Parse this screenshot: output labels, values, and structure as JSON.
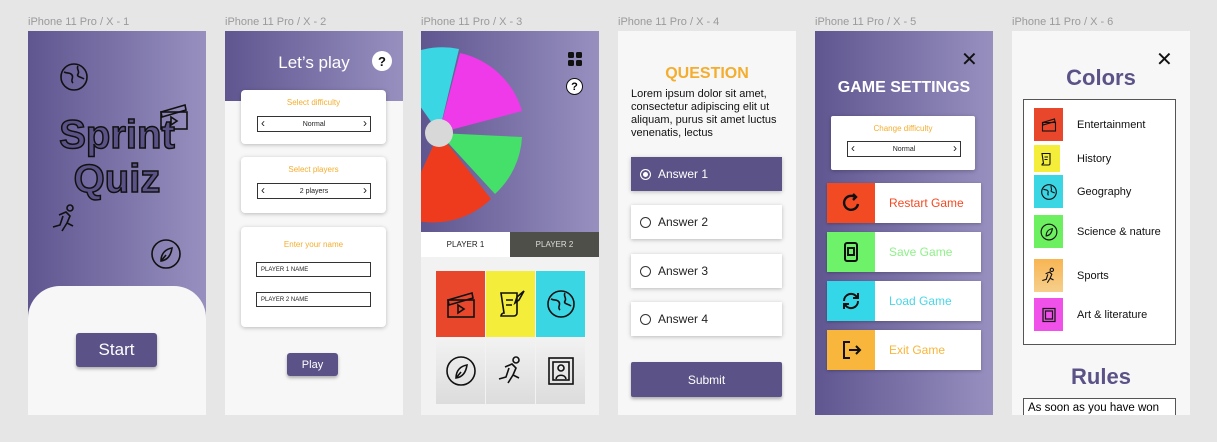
{
  "frames": {
    "f1": {
      "label": "iPhone 11 Pro / X - 1",
      "title_line1": "Sprint",
      "title_line2": "Quiz",
      "start": "Start"
    },
    "f2": {
      "label": "iPhone 11 Pro / X - 2",
      "title": "Let’s play",
      "help": "?",
      "difficulty_heading": "Select difficulty",
      "difficulty_value": "Normal",
      "players_heading": "Select players",
      "players_value": "2 players",
      "name_heading": "Enter your name",
      "player1_placeholder": "PLAYER 1 NAME",
      "player2_placeholder": "PLAYER 2 NAME",
      "play": "Play"
    },
    "f3": {
      "label": "iPhone 11 Pro / X - 3",
      "help": "?",
      "tab1": "PLAYER 1",
      "tab2": "PLAYER 2",
      "tiles": [
        {
          "icon": "clapperboard-icon",
          "color": "#e8472b"
        },
        {
          "icon": "scroll-quill-icon",
          "color": "#f4ee3a"
        },
        {
          "icon": "globe-icon",
          "color": "#3bd6e3"
        },
        {
          "icon": "leaf-icon",
          "color": "#e9e9e9"
        },
        {
          "icon": "runner-icon",
          "color": "#e9e9e9"
        },
        {
          "icon": "portrait-frame-icon",
          "color": "#e9e9e9"
        }
      ]
    },
    "f4": {
      "label": "iPhone 11 Pro / X - 4",
      "heading": "QUESTION",
      "question": "Lorem ipsum dolor sit amet, consectetur adipiscing elit ut aliquam, purus sit amet luctus venenatis, lectus",
      "answers": [
        "Answer 1",
        "Answer 2",
        "Answer 3",
        "Answer 4"
      ],
      "submit": "Submit"
    },
    "f5": {
      "label": "iPhone 11 Pro / X - 5",
      "heading": "GAME SETTINGS",
      "close": "✕",
      "difficulty_heading": "Change difficulty",
      "difficulty_value": "Normal",
      "rows": [
        {
          "label": "Restart Game",
          "icon": "restart-icon",
          "color": "#f24a22",
          "text_color": "#f24a22"
        },
        {
          "label": "Save Game",
          "icon": "save-device-icon",
          "color": "#6ef26a",
          "text_color": "#8ff089"
        },
        {
          "label": "Load Game",
          "icon": "reload-icon",
          "color": "#33d7e8",
          "text_color": "#49d6e7"
        },
        {
          "label": "Exit Game",
          "icon": "exit-icon",
          "color": "#f8b63c",
          "text_color": "#f8b63c"
        }
      ]
    },
    "f6": {
      "label": "iPhone 11 Pro / X - 6",
      "close": "✕",
      "colors_heading": "Colors",
      "categories": [
        {
          "label": "Entertainment",
          "color": "#e8472b",
          "icon": "clapperboard-icon"
        },
        {
          "label": "History",
          "color": "#f4ee3a",
          "icon": "scroll-quill-icon"
        },
        {
          "label": "Geography",
          "color": "#3bd6e3",
          "icon": "globe-icon"
        },
        {
          "label": "Science & nature",
          "color": "#6df060",
          "icon": "leaf-icon"
        },
        {
          "label": "Sports",
          "color": "#f8b552",
          "icon": "runner-icon"
        },
        {
          "label": "Art & literature",
          "color": "#f051e8",
          "icon": "portrait-frame-icon"
        }
      ],
      "rules_heading": "Rules",
      "rules_text": "As soon as you have won"
    }
  }
}
